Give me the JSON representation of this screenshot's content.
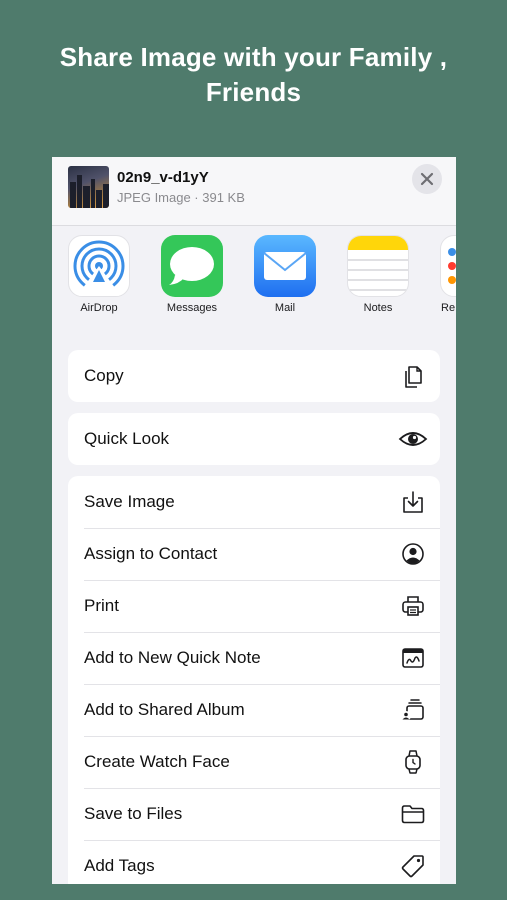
{
  "headline": {
    "line1": "Share Image with your Family ,",
    "line2": "Friends"
  },
  "share_sheet": {
    "file_name": "02n9_v-d1yY",
    "file_meta": "JPEG Image · 391 KB",
    "close_icon": "close-icon"
  },
  "apps": [
    {
      "label": "AirDrop",
      "icon": "airdrop-icon"
    },
    {
      "label": "Messages",
      "icon": "messages-icon"
    },
    {
      "label": "Mail",
      "icon": "mail-icon"
    },
    {
      "label": "Notes",
      "icon": "notes-icon"
    },
    {
      "label": "Re",
      "icon": "reminders-icon"
    }
  ],
  "actions": {
    "copy": {
      "label": "Copy",
      "icon": "copy-icon"
    },
    "quick_look": {
      "label": "Quick Look",
      "icon": "eye-icon"
    },
    "list": [
      {
        "label": "Save Image",
        "icon": "save-icon"
      },
      {
        "label": "Assign to Contact",
        "icon": "person-icon"
      },
      {
        "label": "Print",
        "icon": "printer-icon"
      },
      {
        "label": "Add to New Quick Note",
        "icon": "quick-note-icon"
      },
      {
        "label": "Add to Shared Album",
        "icon": "shared-album-icon"
      },
      {
        "label": "Create Watch Face",
        "icon": "watch-icon"
      },
      {
        "label": "Save to Files",
        "icon": "folder-icon"
      },
      {
        "label": "Add Tags",
        "icon": "tag-icon"
      }
    ]
  },
  "colors": {
    "background": "#4f7b6c",
    "sheet": "#f2f2f6",
    "airdrop": "#3a8ee6",
    "messages": "#34c759",
    "mail": "#1f8efa",
    "notes": "#ffd60a"
  }
}
